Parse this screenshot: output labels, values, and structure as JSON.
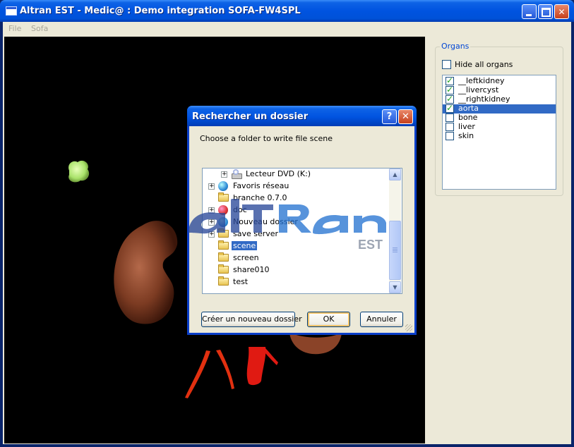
{
  "window": {
    "title": "Altran EST - Medic@ : Demo integration SOFA-FW4SPL",
    "controls": {
      "minimize": "minimize-icon",
      "maximize": "maximize-icon",
      "close": "close-icon"
    }
  },
  "menubar": {
    "items": [
      "File",
      "Sofa"
    ]
  },
  "organs_panel": {
    "title": "Organs",
    "hide_all_label": "Hide all organs",
    "hide_all_checked": false,
    "organs": [
      {
        "label": "__leftkidney",
        "checked": true,
        "selected": false
      },
      {
        "label": "__livercyst",
        "checked": true,
        "selected": false
      },
      {
        "label": "__rightkidney",
        "checked": true,
        "selected": false
      },
      {
        "label": "aorta",
        "checked": true,
        "selected": true
      },
      {
        "label": "bone",
        "checked": false,
        "selected": false
      },
      {
        "label": "liver",
        "checked": false,
        "selected": false
      },
      {
        "label": "skin",
        "checked": false,
        "selected": false
      }
    ]
  },
  "dialog": {
    "title": "Rechercher un dossier",
    "help": "?",
    "close": "✕",
    "prompt": "Choose a folder to write file scene",
    "tree": [
      {
        "label": "Lecteur DVD (K:)",
        "icon": "dvd-drive-icon",
        "expandable": true,
        "selected": false
      },
      {
        "label": "Favoris réseau",
        "icon": "network-globe-icon",
        "expandable": true,
        "selected": false
      },
      {
        "label": "branche 0.7.0",
        "icon": "folder-icon",
        "expandable": false,
        "selected": false
      },
      {
        "label": "doc",
        "icon": "red-globe-icon",
        "expandable": true,
        "selected": false
      },
      {
        "label": "Nouveau dossier",
        "icon": "network-globe-icon",
        "expandable": true,
        "selected": false
      },
      {
        "label": "save server",
        "icon": "folder-icon",
        "expandable": true,
        "selected": false
      },
      {
        "label": "scene",
        "icon": "folder-open-icon",
        "expandable": false,
        "selected": true
      },
      {
        "label": "screen",
        "icon": "folder-icon",
        "expandable": false,
        "selected": false
      },
      {
        "label": "share010",
        "icon": "folder-icon",
        "expandable": false,
        "selected": false
      },
      {
        "label": "test",
        "icon": "folder-icon",
        "expandable": false,
        "selected": false
      }
    ],
    "buttons": {
      "new_folder": "Créer un nouveau dossier",
      "ok": "OK",
      "cancel": "Annuler"
    }
  },
  "watermark": {
    "logo": "altran",
    "sub": "EST"
  },
  "colors": {
    "accent": "#0053e0",
    "selection": "#316ac5",
    "kidney": "#7a3a22",
    "aorta": "#e11010",
    "cyst": "#a9e26a"
  }
}
